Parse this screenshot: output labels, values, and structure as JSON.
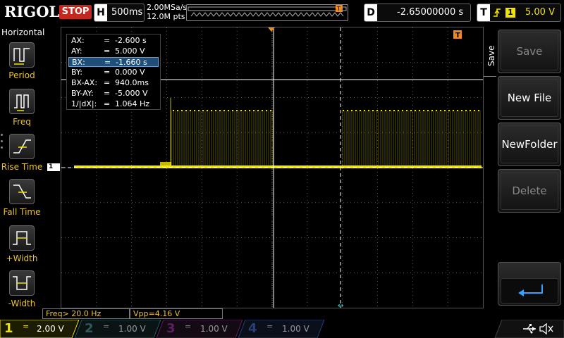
{
  "brand": "RIGOL",
  "run_state": "STOP",
  "timebase": {
    "key": "H",
    "value": "500ms"
  },
  "sample": {
    "rate": "2.00MSa/s",
    "points": "12.0M pts"
  },
  "delay": {
    "key": "D",
    "value": "-2.65000000 s"
  },
  "trigger": {
    "key": "T",
    "source": "1",
    "level": "5.00 V"
  },
  "left_menu": {
    "title": "Horizontal",
    "items": [
      {
        "label": "Period"
      },
      {
        "label": "Freq"
      },
      {
        "label": "Rise Time"
      },
      {
        "label": "Fall Time"
      },
      {
        "label": "+Width"
      },
      {
        "label": "-Width"
      }
    ]
  },
  "right_menu": {
    "title": "Save",
    "buttons": [
      {
        "label": "Save",
        "enabled": false
      },
      {
        "label": "New File",
        "enabled": true
      },
      {
        "label": "NewFolder",
        "enabled": true
      },
      {
        "label": "Delete",
        "enabled": false
      }
    ]
  },
  "cursor_readout": [
    {
      "key": "AX:",
      "value": "-2.600 s"
    },
    {
      "key": "AY:",
      "value": "5.000 V"
    },
    {
      "key": "BX:",
      "value": "-1.660 s"
    },
    {
      "key": "BY:",
      "value": "0.000 V"
    },
    {
      "key": "BX-AX:",
      "value": "940.0ms"
    },
    {
      "key": "BY-AY:",
      "value": "-5.000 V"
    },
    {
      "key": "1/|dX|:",
      "value": "1.064 Hz"
    }
  ],
  "channel_marker": "1",
  "measurements": [
    {
      "text": "Freq> 20.0 Hz"
    },
    {
      "text": "Vpp=4.16 V"
    }
  ],
  "channels": [
    {
      "num": "1",
      "coupling": "=",
      "scale": "2.00 V",
      "color": "#f2e600",
      "active": true
    },
    {
      "num": "2",
      "coupling": "=",
      "scale": "1.00 V",
      "color": "#37d6e0",
      "active": false
    },
    {
      "num": "3",
      "coupling": "=",
      "scale": "1.00 V",
      "color": "#d01adf",
      "active": false
    },
    {
      "num": "4",
      "coupling": "=",
      "scale": "1.00 V",
      "color": "#3a6fe8",
      "active": false
    }
  ],
  "colors": {
    "trace": "#f2e600",
    "stop": "#c4271e",
    "trigger": "#f08a1c",
    "grid": "#5a5a5a"
  }
}
